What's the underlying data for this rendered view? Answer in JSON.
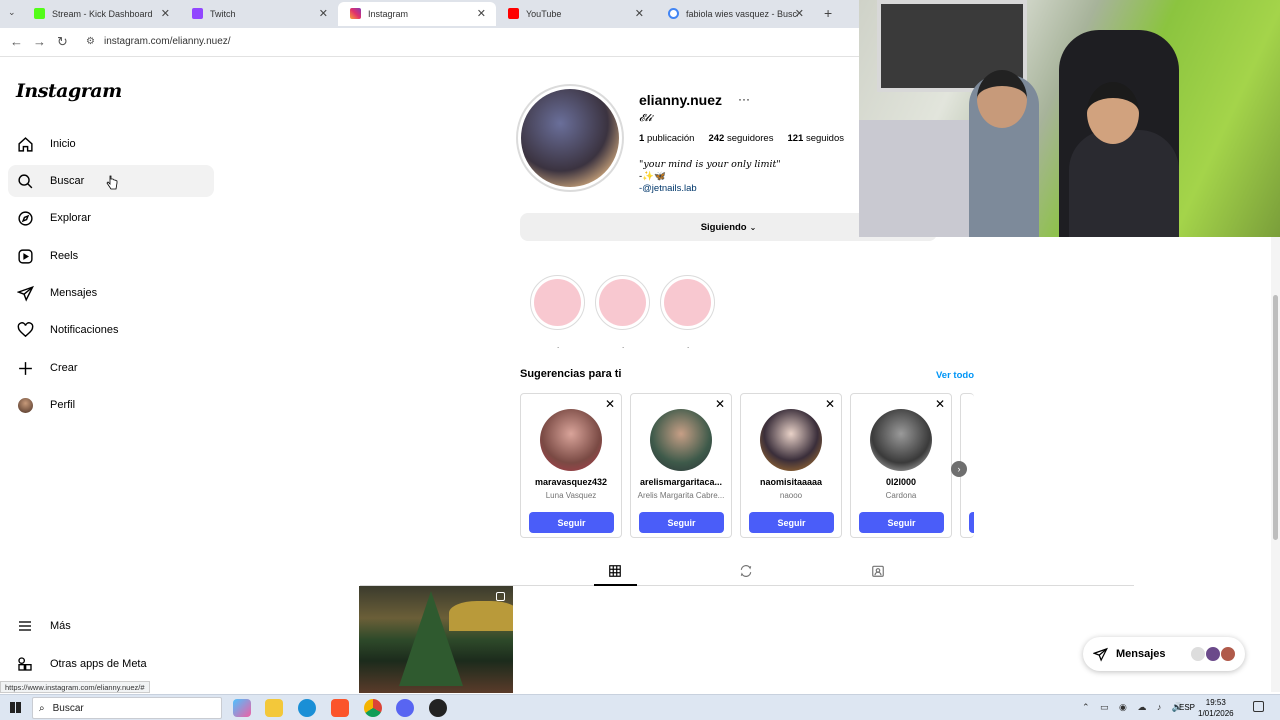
{
  "browser": {
    "tabs": [
      {
        "title": "Stream - Kick Dashboard",
        "icon": "kick-icon",
        "color": "#53fc18"
      },
      {
        "title": "Twitch",
        "icon": "twitch-icon",
        "color": "#9146ff"
      },
      {
        "title": "Instagram",
        "icon": "instagram-icon",
        "color": "#e1306c"
      },
      {
        "title": "YouTube",
        "icon": "youtube-icon",
        "color": "#ff0000"
      },
      {
        "title": "fabiola wies vasquez - Buscar c",
        "icon": "google-icon",
        "color": "#4285f4"
      }
    ],
    "new_tab": "+",
    "url": "instagram.com/elianny.nuez/"
  },
  "sidebar": {
    "logo": "Instagram",
    "items": [
      {
        "label": "Inicio",
        "icon": "home-icon"
      },
      {
        "label": "Buscar",
        "icon": "search-icon"
      },
      {
        "label": "Explorar",
        "icon": "compass-icon"
      },
      {
        "label": "Reels",
        "icon": "reels-icon"
      },
      {
        "label": "Mensajes",
        "icon": "send-icon"
      },
      {
        "label": "Notificaciones",
        "icon": "heart-icon"
      },
      {
        "label": "Crear",
        "icon": "plus-icon"
      },
      {
        "label": "Perfil",
        "icon": "avatar"
      }
    ],
    "more": "Más",
    "meta_apps": "Otras apps de Meta"
  },
  "profile": {
    "username": "elianny.nuez",
    "options": "···",
    "full_name": "𝓔𝓵𝓲",
    "posts": "1",
    "posts_label": "publicación",
    "followers": "242",
    "followers_label": "seguidores",
    "following": "121",
    "following_label": "seguidos",
    "bio_line1": "\"your mind is your only limit\"",
    "bio_line2": "-✨🦋",
    "bio_line3": "-@jetnails.lab",
    "following_button": "Siguiendo",
    "highlight_dots": [
      ".",
      ".",
      "."
    ]
  },
  "suggestions": {
    "title": "Sugerencias para ti",
    "see_all": "Ver todo",
    "follow_label": "Seguir",
    "cards": [
      {
        "username": "maravasquez432",
        "name": "Luna Vasquez"
      },
      {
        "username": "arelismargaritaca...",
        "name": "Arelis Margarita Cabre..."
      },
      {
        "username": "naomisitaaaaa",
        "name": "naooo"
      },
      {
        "username": "0l2l000",
        "name": "Cardona"
      }
    ]
  },
  "status_url": "https://www.instagram.com/elianny.nuez/#",
  "messages_pill": "Mensajes",
  "taskbar": {
    "search_label": "Buscar",
    "language": "ESP",
    "time": "19:53",
    "date": "1/01/2026"
  }
}
